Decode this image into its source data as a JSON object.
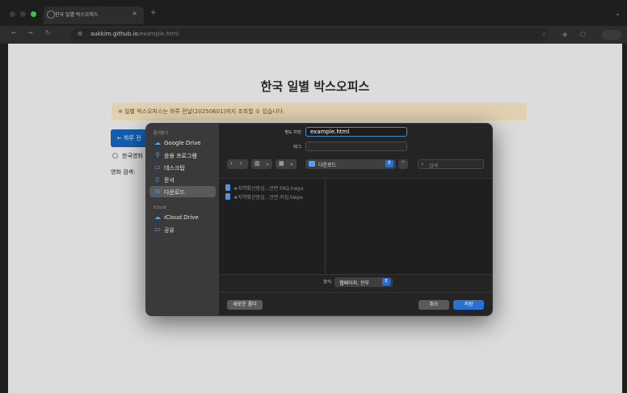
{
  "browser": {
    "tab_title": "한국 일별 박스오피스",
    "tab_close": "×",
    "new_tab": "+",
    "tab_menu": "⌄",
    "url_host": "aukkim.github.io",
    "url_path": "/example.html",
    "nav": {
      "back": "←",
      "forward": "→",
      "reload": "↻"
    }
  },
  "page": {
    "title": "한국 일별 박스오피스",
    "notice": "※ 일별 박스오피스는 하루 전날(20250601)까지 조회할 수 있습니다.",
    "prev_button": "← 하루 전",
    "radio_label": "한국영화",
    "search_label": "영화 검색:"
  },
  "dialog": {
    "sidebar": {
      "favorites_header": "즐겨찾기",
      "favorites": [
        {
          "icon": "cloud-drive-icon",
          "glyph": "☁",
          "label": "Google Drive"
        },
        {
          "icon": "applications-icon",
          "glyph": "⚲",
          "label": "응용 프로그램"
        },
        {
          "icon": "desktop-icon",
          "glyph": "▭",
          "label": "데스크탑"
        },
        {
          "icon": "document-icon",
          "glyph": "▯",
          "label": "문서"
        },
        {
          "icon": "downloads-icon",
          "glyph": "⊙",
          "label": "다운로드",
          "selected": true
        }
      ],
      "icloud_header": "iCloud",
      "icloud": [
        {
          "icon": "icloud-icon",
          "glyph": "☁",
          "label": "iCloud Drive"
        },
        {
          "icon": "shared-folder-icon",
          "glyph": "▭",
          "label": "공유"
        }
      ]
    },
    "save_as_label": "별도 저장:",
    "filename": "example.html",
    "tags_label": "태그:",
    "location": "다운로드",
    "search_placeholder": "검색",
    "files": [
      "★지역확산증심...관련 FAQ.hwpx",
      "★지역확산증심...관련 지침.hwpx"
    ],
    "format_label": "형식:",
    "format_value": "웹페이지, 전부",
    "new_folder_button": "새로운 폴더",
    "cancel_button": "취소",
    "save_button": "저장"
  }
}
